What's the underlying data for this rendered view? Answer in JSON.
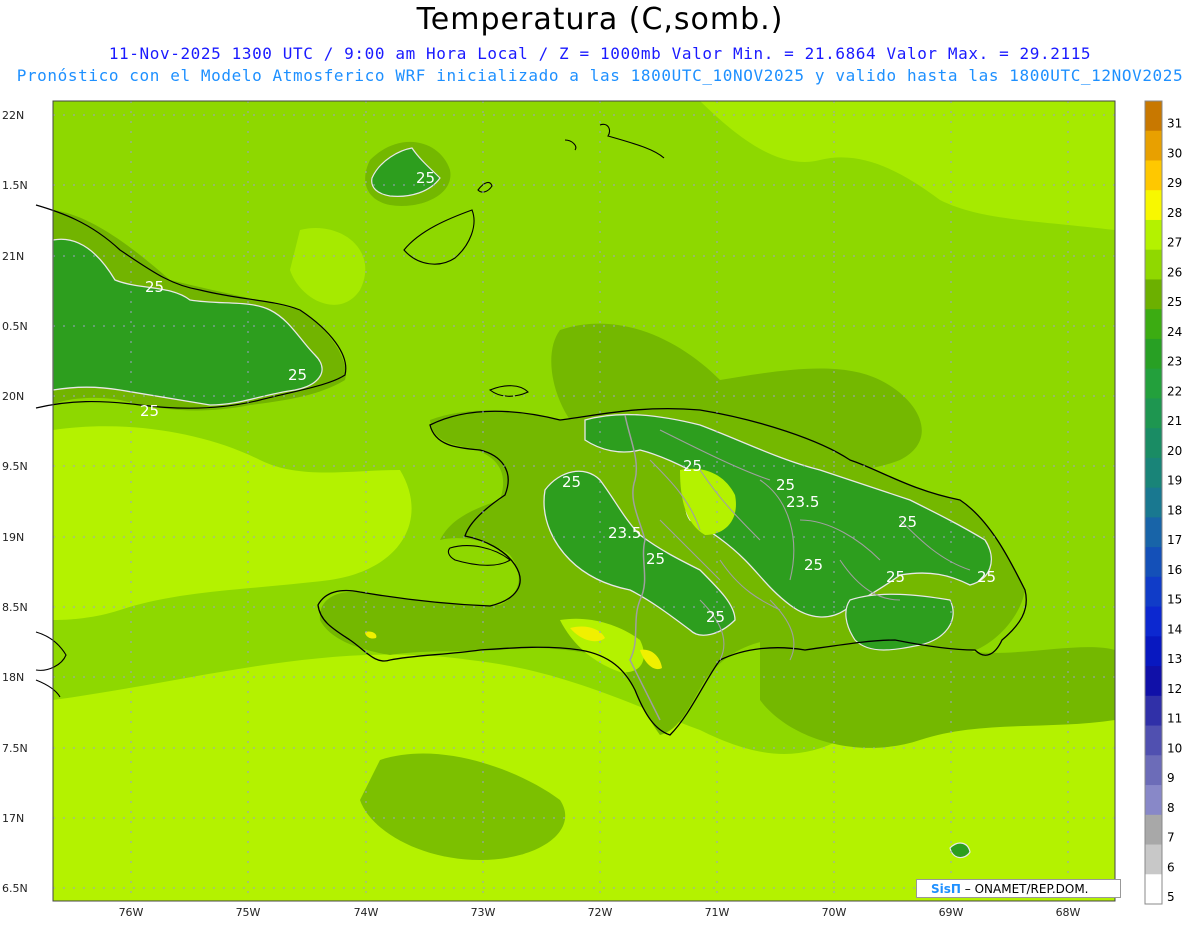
{
  "header": {
    "title": "Temperatura (C,somb.)",
    "line1": "11-Nov-2025  1300 UTC / 9:00 am Hora Local / Z = 1000mb   Valor Min. = 21.6864  Valor Max. = 29.2115",
    "line2": "Pronóstico con el Modelo Atmosferico WRF inicializado a las 1800UTC_10NOV2025 y valido hasta las  1800UTC_12NOV2025"
  },
  "map": {
    "lat_labels": [
      "22N",
      "1.5N",
      "21N",
      "0.5N",
      "20N",
      "9.5N",
      "19N",
      "8.5N",
      "18N",
      "7.5N",
      "17N",
      "6.5N"
    ],
    "lon_labels": [
      "76W",
      "75W",
      "74W",
      "73W",
      "72W",
      "71W",
      "70W",
      "69W",
      "68W"
    ],
    "contour_labels": [
      "25",
      "25",
      "25",
      "25",
      "25",
      "25",
      "23.5",
      "25",
      "25",
      "23.5",
      "25",
      "25",
      "25",
      "25",
      "25"
    ],
    "colors": {
      "background": "#8ed800",
      "light": "#b4f200",
      "mid": "#68b000",
      "dark": "#2d9e1e",
      "warm": "#f0f000",
      "coast": "#000000",
      "border": "#a0a0a0"
    }
  },
  "colorbar": {
    "levels": [
      "31",
      "30",
      "29",
      "28",
      "27",
      "26",
      "25",
      "24",
      "23",
      "22",
      "21",
      "20",
      "19",
      "18",
      "17",
      "16",
      "15",
      "14",
      "13",
      "12",
      "11",
      "10",
      "9",
      "8",
      "7",
      "6",
      "5"
    ],
    "colors": [
      "#c87800",
      "#e8a000",
      "#ffc800",
      "#f8f800",
      "#b4f200",
      "#90d800",
      "#6cb000",
      "#3cac12",
      "#28a024",
      "#23a03c",
      "#1e9650",
      "#1a8c64",
      "#198478",
      "#197890",
      "#1864a8",
      "#1450b8",
      "#103cc8",
      "#0c28d0",
      "#0818c0",
      "#1010a8",
      "#3030a8",
      "#5050b0",
      "#6c6cb8",
      "#8888c8",
      "#a8a8a8",
      "#c8c8c8",
      "#ffffff"
    ]
  },
  "credit": {
    "logo": "SisΠ",
    "text": "– ONAMET/REP.DOM."
  }
}
